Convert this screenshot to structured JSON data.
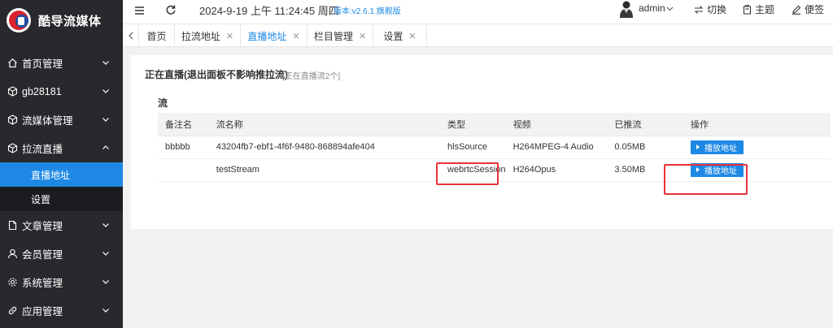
{
  "app": {
    "title": "酷导流媒体"
  },
  "sidebar": {
    "items": [
      {
        "label": "首页管理",
        "icon": "home-icon",
        "expanded": false
      },
      {
        "label": "gb28181",
        "icon": "cube-icon",
        "expanded": false
      },
      {
        "label": "流媒体管理",
        "icon": "cube-icon",
        "expanded": false
      },
      {
        "label": "拉流直播",
        "icon": "cube-icon",
        "expanded": true,
        "children": [
          {
            "label": "直播地址",
            "active": true
          },
          {
            "label": "设置",
            "active": false
          }
        ]
      },
      {
        "label": "文章管理",
        "icon": "document-icon",
        "expanded": false
      },
      {
        "label": "会员管理",
        "icon": "user-icon",
        "expanded": false
      },
      {
        "label": "系统管理",
        "icon": "gear-icon",
        "expanded": false
      },
      {
        "label": "应用管理",
        "icon": "link-icon",
        "expanded": false
      }
    ]
  },
  "header": {
    "datetime": "2024-9-19 上午 11:24:45 周四",
    "version": "版本:v2.6.1 旗舰版",
    "user": "admin",
    "switch_label": "切换",
    "theme_label": "主题",
    "notes_label": "便签"
  },
  "tabs": [
    {
      "label": "首页",
      "closable": false,
      "active": false
    },
    {
      "label": "拉流地址",
      "closable": true,
      "active": false
    },
    {
      "label": "直播地址",
      "closable": true,
      "active": true
    },
    {
      "label": "栏目管理",
      "closable": true,
      "active": false
    },
    {
      "label": "设置",
      "closable": true,
      "active": false
    }
  ],
  "main": {
    "title": "正在直播(退出面板不影响推拉流)",
    "subtitle": "[正在直播流2个]",
    "section": "流",
    "table": {
      "columns": [
        "备注名",
        "流名称",
        "类型",
        "视频",
        "已推流",
        "操作"
      ],
      "rows": [
        {
          "note": "bbbbb",
          "name": "43204fb7-ebf1-4f6f-9480-868894afe404",
          "type": "hlsSource",
          "video": "H264MPEG-4 Audio",
          "pushed": "0.05MB",
          "action": "播放地址"
        },
        {
          "note": "",
          "name": "testStream",
          "type": "webrtcSession",
          "video": "H264Opus",
          "pushed": "3.50MB",
          "action": "播放地址"
        }
      ]
    }
  },
  "colors": {
    "sidebar_bg": "#28292d",
    "accent": "#1e88e5",
    "highlight": "#e8323a"
  }
}
